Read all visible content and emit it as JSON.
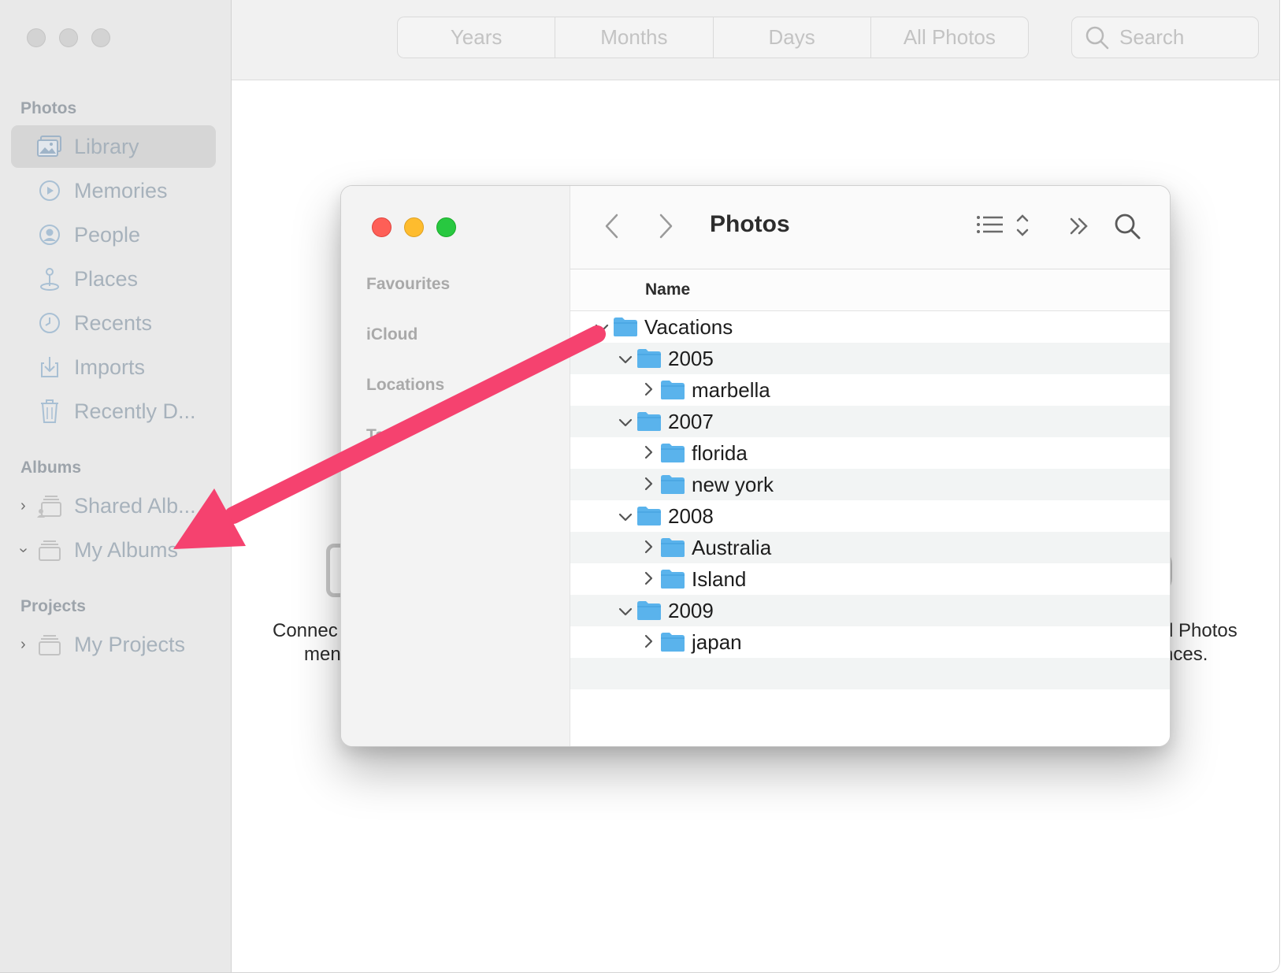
{
  "photos_app": {
    "sidebar": {
      "photos_heading": "Photos",
      "items": [
        {
          "label": "Library",
          "icon": "library-icon"
        },
        {
          "label": "Memories",
          "icon": "memories-icon"
        },
        {
          "label": "People",
          "icon": "people-icon"
        },
        {
          "label": "Places",
          "icon": "places-icon"
        },
        {
          "label": "Recents",
          "icon": "recents-icon"
        },
        {
          "label": "Imports",
          "icon": "imports-icon"
        },
        {
          "label": "Recently D...",
          "icon": "trash-icon"
        }
      ],
      "albums_heading": "Albums",
      "albums": [
        {
          "label": "Shared Alb...",
          "icon": "shared-albums-icon"
        },
        {
          "label": "My Albums",
          "icon": "albums-icon"
        }
      ],
      "projects_heading": "Projects",
      "projects": [
        {
          "label": "My Projects",
          "icon": "projects-icon"
        }
      ]
    },
    "toolbar": {
      "segments": [
        "Years",
        "Months",
        "Days",
        "All Photos"
      ],
      "search_placeholder": "Search"
    },
    "main": {
      "left_text_line1": "Connec",
      "left_text_line2": "men",
      "right_text_line1": "d Photos",
      "right_text_line2": "nces."
    }
  },
  "finder": {
    "title": "Photos",
    "sidebar": {
      "favourites": "Favourites",
      "icloud": "iCloud",
      "locations": "Locations",
      "tags": "Ta"
    },
    "column_header": "Name",
    "rows": [
      {
        "label": "Vacations",
        "level": 0,
        "expanded": true
      },
      {
        "label": "2005",
        "level": 1,
        "expanded": true
      },
      {
        "label": "marbella",
        "level": 2,
        "expanded": false
      },
      {
        "label": "2007",
        "level": 1,
        "expanded": true
      },
      {
        "label": "florida",
        "level": 2,
        "expanded": false
      },
      {
        "label": "new york",
        "level": 2,
        "expanded": false
      },
      {
        "label": "2008",
        "level": 1,
        "expanded": true
      },
      {
        "label": "Australia",
        "level": 2,
        "expanded": false
      },
      {
        "label": "Island",
        "level": 2,
        "expanded": false
      },
      {
        "label": "2009",
        "level": 1,
        "expanded": true
      },
      {
        "label": "japan",
        "level": 2,
        "expanded": false
      }
    ],
    "folder_color": "#5ab3ec"
  },
  "annotation": {
    "arrow_color": "#f5426f"
  }
}
